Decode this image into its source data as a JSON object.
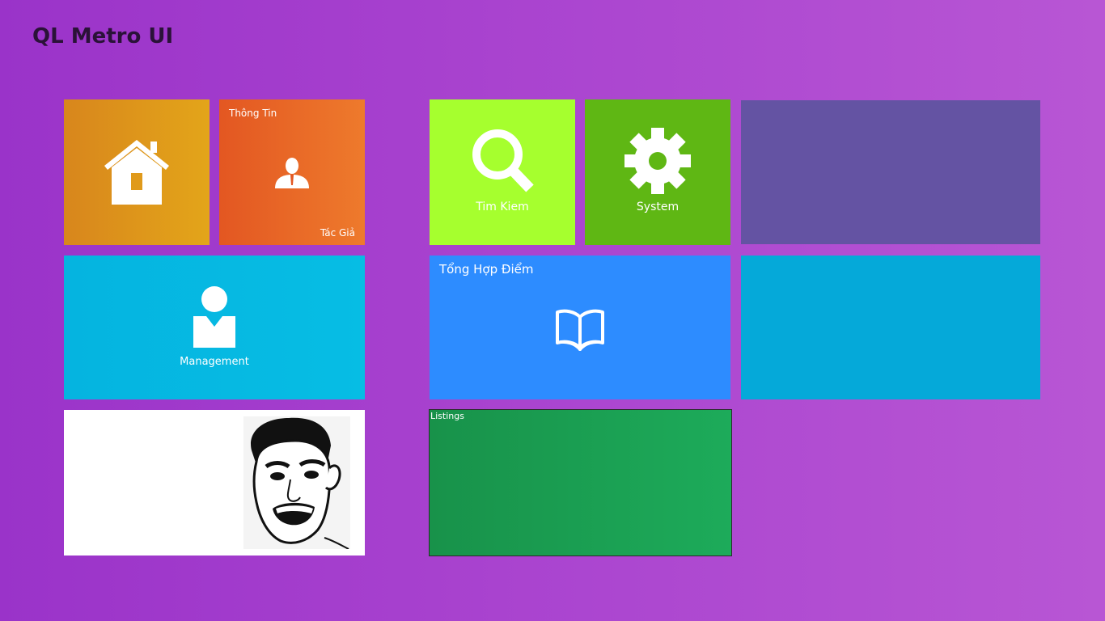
{
  "app": {
    "title": "QL Metro UI"
  },
  "tiles": {
    "home": {
      "icon": "house-icon"
    },
    "author": {
      "top_label": "Thông Tin",
      "bottom_label": "Tác Giả",
      "icon": "person-icon"
    },
    "search": {
      "label": "Tim Kiem",
      "icon": "magnifier-icon"
    },
    "system": {
      "label": "System",
      "icon": "gear-icon"
    },
    "violet": {
      "color": "#6453a3"
    },
    "management": {
      "label": "Management",
      "icon": "user-icon"
    },
    "scores": {
      "label": "Tổng Hợp Điểm",
      "icon": "open-book-icon"
    },
    "cyan": {
      "color": "#05a9d9"
    },
    "meme": {
      "image": "meme-face"
    },
    "listings": {
      "label": "Listings"
    }
  },
  "colors": {
    "home": "#e09a1b",
    "author": "#e8672a",
    "search": "#a6ff2e",
    "system": "#5fb714",
    "management": "#05b8e2",
    "scores": "#2d8cff",
    "listings": "#1b9e52"
  }
}
